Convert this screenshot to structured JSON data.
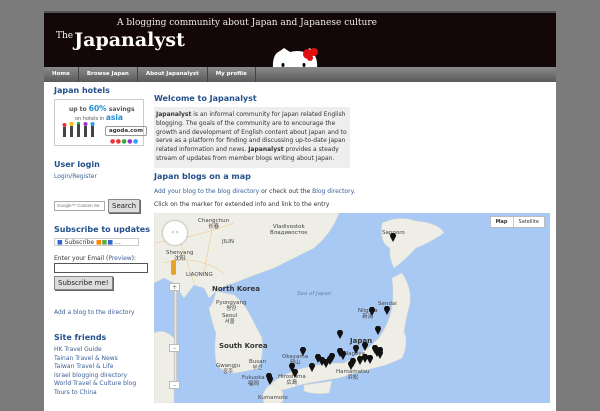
{
  "header": {
    "tagline": "A blogging community about Japan and Japanese culture",
    "logo_prefix": "The",
    "logo": "Japanalyst"
  },
  "nav": [
    "Home",
    "Browse Japan",
    "About Japanalyst",
    "My profile"
  ],
  "sidebar": {
    "hotels_title": "Japan hotels",
    "ad": {
      "line1": "up to",
      "pct": "60%",
      "line1b": "savings",
      "line2": "on hotels in",
      "region": "asia",
      "brand": "agoda.com"
    },
    "login_title": "User login",
    "login_link": "Login/Register",
    "search_placeholder": "Google™ Custom Se",
    "search_button": "Search",
    "subscribe_title": "Subscribe to updates",
    "subscribe_badge": "Subscribe",
    "email_label": "Enter your Email (",
    "email_preview": "Preview",
    "email_label_end": "):",
    "subscribe_button": "Subscribe me!",
    "add_blog": "Add a blog to the directory",
    "friends_title": "Site friends",
    "friends": [
      "HK Travel Guide",
      "Tainan Travel & News",
      "Taiwan Travel & Life",
      "Israel blogging directory",
      "World Travel & Culture blog",
      "Tours to China"
    ]
  },
  "main": {
    "welcome_title": "Welcome to Japanalyst",
    "intro_bold1": "Japanalyst",
    "intro_text1": " is an informal community for Japan related English blogging. The goals of the community are to encourage the growth and development of English content about Japan and to serve as a platform for finding and discussing up-to-date Japan related information and news. ",
    "intro_bold2": "Japanalyst",
    "intro_text2": " provides a steady stream of updates from member blogs writing about Japan.",
    "map_title": "Japan blogs on a map",
    "add_link": "Add your blog to the blog directory",
    "mid_text": " or check out the ",
    "dir_link": "Blog directory",
    "click_text": "Click on the marker for extended info and link to the entry"
  },
  "map": {
    "types": [
      "Map",
      "Satellite"
    ],
    "labels": {
      "changchun": "Changchun\n长春",
      "jilin": "JILIN",
      "vladivostok": "Vladivostok\nВладивосток",
      "shenyang": "Shenyang\n沈阳",
      "liaoning": "LIAONING",
      "north_korea": "North Korea",
      "pyongyang": "Pyongyang\n평양",
      "seoul": "Seoul\n서울",
      "south_korea": "South Korea",
      "gwangju": "Gwangju\n광주",
      "busan": "Busan\n부산",
      "fukuoka": "Fukuoka\n福岡",
      "kumamoto": "Kumamoto",
      "hiroshima": "Hiroshima\n広島",
      "okayama": "Okayama\n岡山",
      "nagoya": "Nagoya",
      "hamamatsu": "Hamamatsu\n浜松",
      "japan": "Japan",
      "niigata": "Niigata\n新潟",
      "sendai": "Sendai",
      "sapporo": "Sapporo",
      "sea": "Sea of Japan"
    }
  }
}
